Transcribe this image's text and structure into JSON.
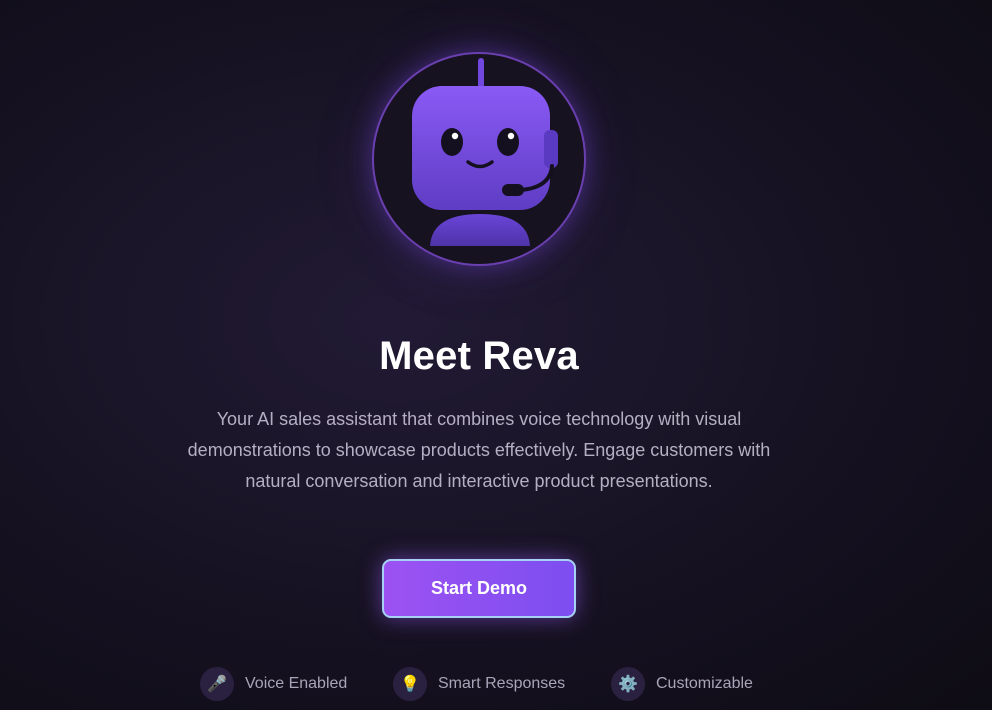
{
  "hero": {
    "avatar_icon": "robot-with-headset-icon",
    "title": "Meet Reva",
    "description": "Your AI sales assistant that combines voice technology with visual demonstrations to showcase products effectively. Engage customers with natural conversation and interactive product presentations."
  },
  "cta": {
    "label": "Start Demo"
  },
  "features": [
    {
      "icon": "microphone-icon",
      "glyph": "🎤",
      "label": "Voice Enabled"
    },
    {
      "icon": "lightbulb-icon",
      "glyph": "💡",
      "label": "Smart Responses"
    },
    {
      "icon": "gear-icon",
      "glyph": "⚙️",
      "label": "Customizable"
    }
  ],
  "colors": {
    "accent": "#7d4ef0",
    "accent_light": "#9d52f2",
    "button_border": "#a7d0f5",
    "background": "#1a1528",
    "text_muted": "#b4afc2"
  }
}
